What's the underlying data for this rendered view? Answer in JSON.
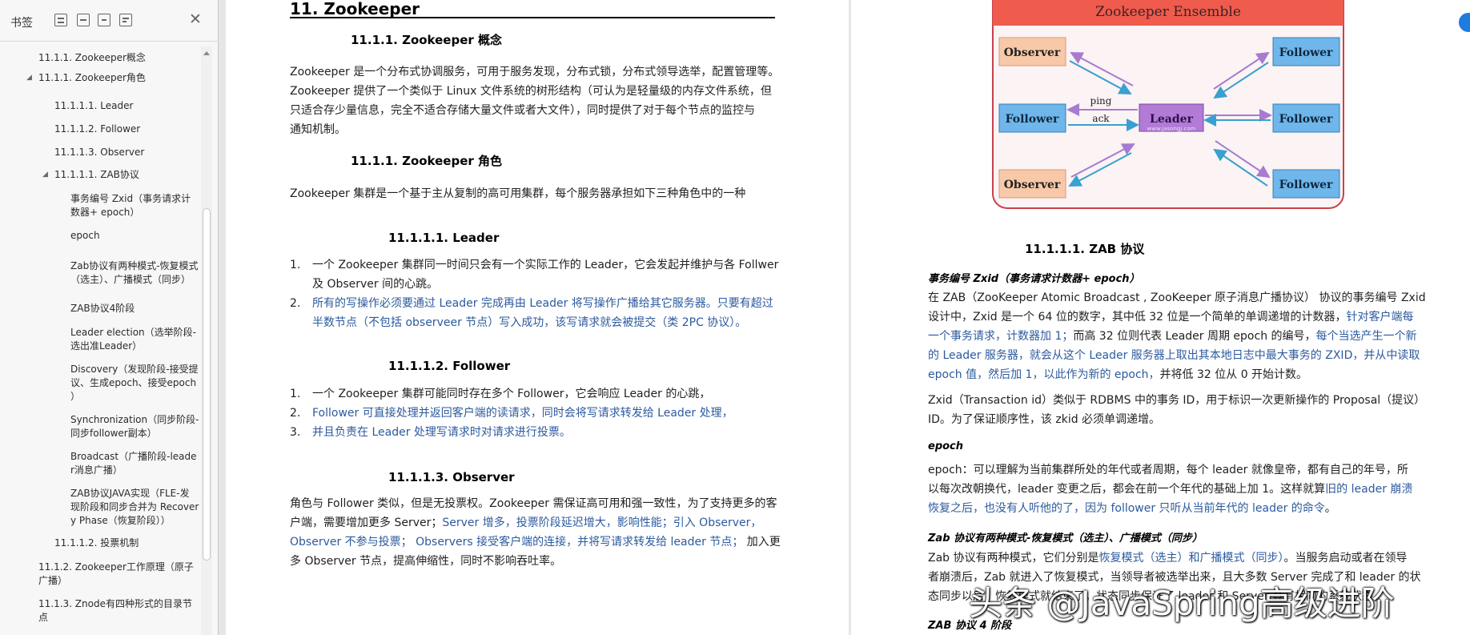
{
  "sidebar": {
    "title": "书签",
    "items": [
      "11.1.1. Zookeeper概念",
      "11.1.1. Zookeeper角色",
      "11.1.1.1. Leader",
      "11.1.1.2. Follower",
      "11.1.1.3. Observer",
      "11.1.1.1. ZAB协议",
      "事务编号 Zxid（事务请求计",
      "数器+ epoch）",
      "epoch",
      "Zab协议有两种模式-恢复模式",
      "（选主）、广播模式（同步）",
      "ZAB协议4阶段",
      "Leader election（选举阶段-",
      "选出准Leader）",
      "Discovery（发现阶段-接受提",
      "议、生成epoch、接受epoch",
      "）",
      "Synchronization（同步阶段-",
      "同步follower副本）",
      "Broadcast（广播阶段-leade",
      "r消息广播）",
      "ZAB协议JAVA实现（FLE-发",
      "现阶段和同步合并为 Recover",
      "y Phase（恢复阶段））",
      "11.1.1.2. 投票机制",
      "11.1.2. Zookeeper工作原理（原子",
      "广播）",
      "11.1.3.   Znode有四种形式的目录节",
      "点"
    ]
  },
  "page1": {
    "chapter": "11.   Zookeeper",
    "h_concept": "11.1.1.    Zookeeper 概念",
    "concept_lines": [
      "Zookeeper 是一个分布式协调服务，可用于服务发现，分布式锁，分布式领导选举，配置管理等。",
      "Zookeeper 提供了一个类似于 Linux 文件系统的树形结构（可认为是轻量级的内存文件系统，但",
      "只适合存少量信息，完全不适合存储大量文件或者大文件），同时提供了对于每个节点的监控与",
      "通知机制。"
    ],
    "h_roles": "11.1.1.    Zookeeper 角色",
    "roles_line": "Zookeeper 集群是一个基于主从复制的高可用集群，每个服务器承担如下三种角色中的一种",
    "h_leader": "11.1.1.1.   Leader",
    "leader_items": [
      {
        "n": "1.",
        "a": "一个 Zookeeper 集群同一时间只会有一个实际工作的 Leader，它会发起并维护与各 Follwer",
        "b": "及 Observer 间的心跳。"
      },
      {
        "n": "2.",
        "a": "所有的写操作必须要通过 Leader 完成再由 Leader 将写操作广播给其它服务器。只要有超过",
        "b": "半数节点（不包括 observeer 节点）写入成功，该写请求就会被提交（类 2PC 协议）。"
      }
    ],
    "h_follower": "11.1.1.2.   Follower",
    "follower_items": [
      {
        "n": "1.",
        "t": "一个 Zookeeper 集群可能同时存在多个 Follower，它会响应 Leader 的心跳，"
      },
      {
        "n": "2.",
        "t": "Follower 可直接处理并返回客户端的读请求，同时会将写请求转发给 Leader 处理，"
      },
      {
        "n": "3.",
        "t": "并且负责在 Leader 处理写请求时对请求进行投票。"
      }
    ],
    "h_observer": "11.1.1.3.   Observer",
    "observer_l1": "角色与 Follower 类似，但是无投票权。Zookeeper 需保证高可用和强一致性，为了支持更多的客",
    "observer_l2a": "户端，需要增加更多 Server；",
    "observer_l2b": "Server 增多，投票阶段延迟增大，影响性能；引入 Observer，",
    "observer_l3a": "Observer 不参与投票；  Observers 接受客户端的连接，并将写请求转发给 leader 节点；",
    "observer_l3b": "  加入更",
    "observer_l4": "多 Observer 节点，提高伸缩性，同时不影响吞吐率。"
  },
  "diagram": {
    "title": "Zookeeper Ensemble",
    "leader": "Leader",
    "observer": "Observer",
    "follower": "Follower",
    "ping": "ping",
    "ack": "ack",
    "site": "www.jasongj.com",
    "colors": {
      "header": "#ef5b4c",
      "leader": "#b27bd6",
      "follower": "#6fb6ea",
      "observer": "#f8c9a8",
      "arrow_purple": "#a77bd0",
      "arrow_blue": "#39a0cf"
    }
  },
  "page2": {
    "h_zab": "11.1.1.1.   ZAB 协议",
    "h_zxid": "事务编号 Zxid（事务请求计数器+ epoch）",
    "zxid_l1": "在 ZAB（ZooKeeper Atomic Broadcast , ZooKeeper 原子消息广播协议） 协议的事务编号 Zxid",
    "zxid_l2a": "设计中，Zxid 是一个 64 位的数字，其中低 32 位是一个简单的单调递增的计数器，",
    "zxid_l2b": "针对客户端每",
    "zxid_l3a": "一个事务请求，计数器加 1；",
    "zxid_l3b": "而高 32 位则代表 Leader 周期 epoch 的编号，",
    "zxid_l3c": "每个当选产生一个新",
    "zxid_l4": "的 Leader 服务器，就会从这个 Leader 服务器上取出其本地日志中最大事务的 ZXID，并从中读取",
    "zxid_l5a": "epoch 值，然后加 1，以此作为新的 epoch，",
    "zxid_l5b": "并将低 32 位从 0 开始计数。",
    "zxid_l6": "Zxid（Transaction id）类似于 RDBMS 中的事务 ID，用于标识一次更新操作的 Proposal（提议）",
    "zxid_l7": "ID。为了保证顺序性，该 zkid 必须单调递增。",
    "h_epoch": "epoch",
    "epoch_l1": "epoch：可以理解为当前集群所处的年代或者周期，每个  leader  就像皇帝，都有自己的年号，所",
    "epoch_l2a": "以每次改朝换代，leader 变更之后，都会在前一个年代的基础上加 1。这样就算",
    "epoch_l2b": "旧的 leader 崩溃",
    "epoch_l3a": "恢复之后，也没有人听他的了，因为 follower 只听从当前年代的 leader 的命令",
    "epoch_l3b": "。",
    "h_modes": "Zab 协议有两种模式-恢复模式（选主）、广播模式（同步）",
    "modes_l1a": "Zab 协议有两种模式，它们分别是",
    "modes_l1b": "恢复模式（选主）和广播模式（同步）",
    "modes_l1c": "。当服务启动或者在领导",
    "modes_l2": "者崩溃后，Zab 就进入了恢复模式，当领导者被选举出来，且大多数 Server 完成了和 leader 的状",
    "modes_l3": "态同步以后，恢复模式就结束了。状态同步保证了 leader 和 Server 具有相同的系统状态。",
    "h_phases": "ZAB 协议 4 阶段"
  },
  "watermark": "头条 @JavaSpring高级进阶"
}
